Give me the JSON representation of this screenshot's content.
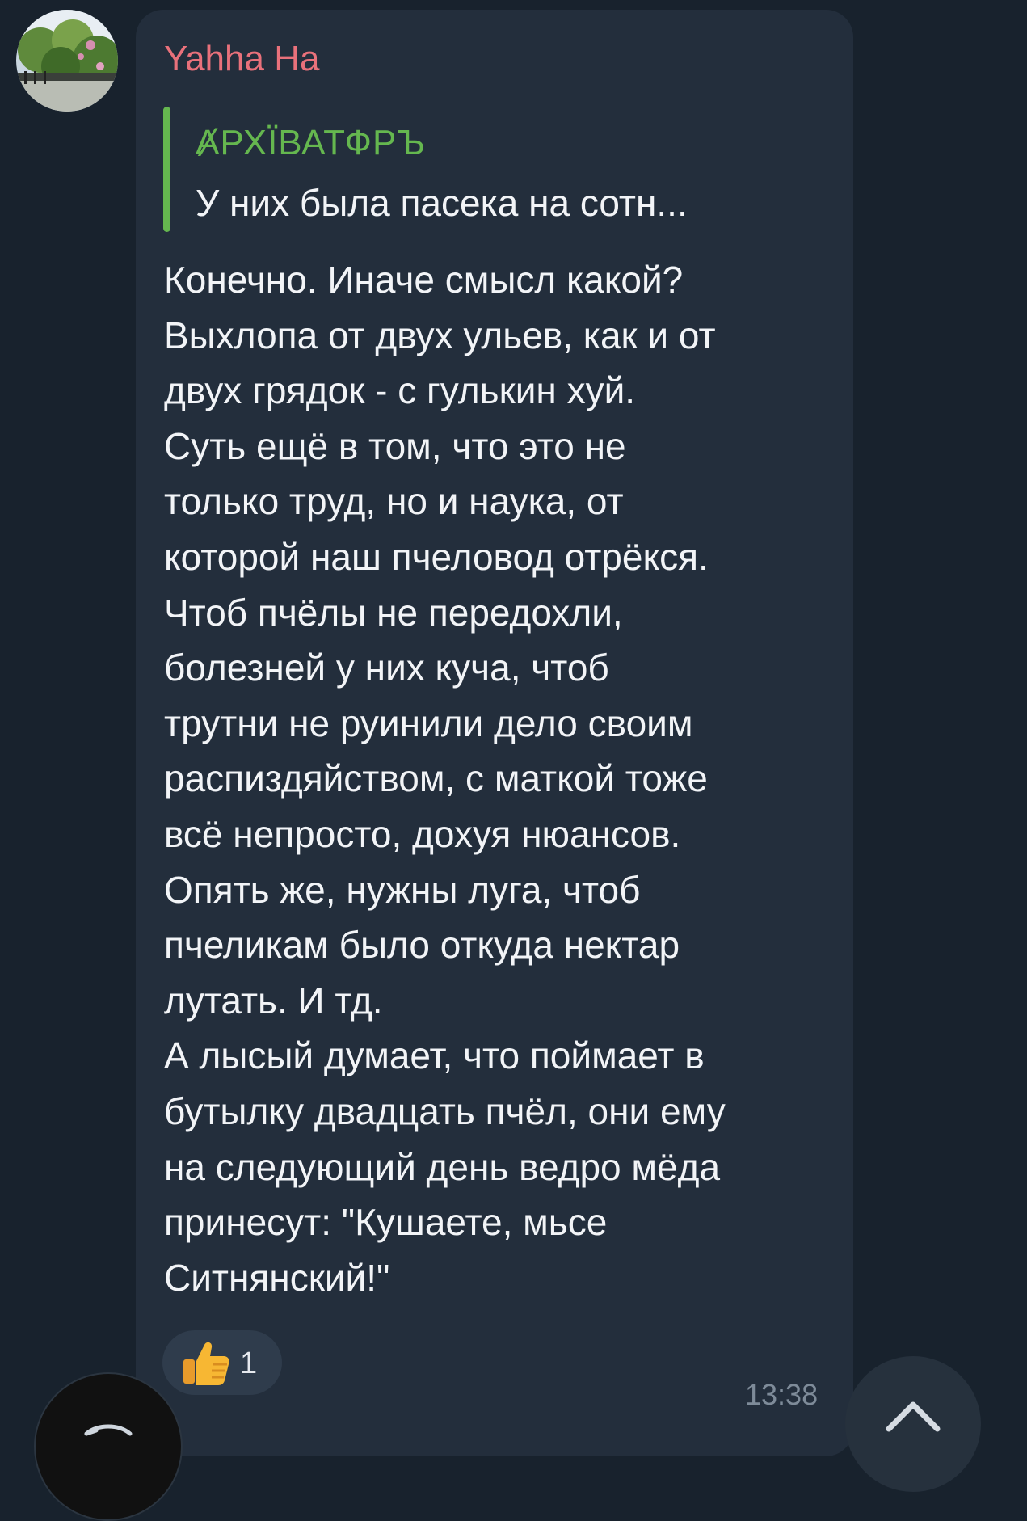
{
  "message": {
    "sender": "Yahha Ha",
    "reply": {
      "author": "ȺРХЇВАТФРЪ",
      "text": "У них была пасека на сотн..."
    },
    "lines": [
      "Конечно. Иначе смысл какой?",
      "Выхлопа от двух ульев, как и от",
      "двух грядок - с гулькин хуй.",
      "Суть ещё в том, что это не",
      "только труд, но и наука, от",
      "которой наш пчеловод отрёкся.",
      "Чтоб пчёлы не передохли,",
      "болезней у них куча, чтоб",
      "трутни не руинили дело своим",
      "распиздяйством, с маткой тоже",
      "всё непросто, дохуя нюансов.",
      "Опять же, нужны луга, чтоб",
      "пчеликам было откуда нектар",
      "лутать. И тд.",
      "А лысый думает, что поймает в",
      "бутылку двадцать пчёл, они ему",
      "на следующий день ведро мёда",
      "принесут: \"Кушаете, мьсе",
      "Ситнянский!\""
    ],
    "reaction": {
      "emoji": "thumbs-up-icon",
      "count": "1"
    },
    "time": "13:38"
  },
  "colors": {
    "background": "#18222d",
    "bubble": "#232e3c",
    "sender": "#e9717b",
    "reply_accent": "#65b74f",
    "text": "#f2f4f7",
    "meta": "#7e8b99"
  },
  "icons": {
    "scroll_down": "chevron-up-icon",
    "bottom_left": "reply-arrow-icon"
  }
}
